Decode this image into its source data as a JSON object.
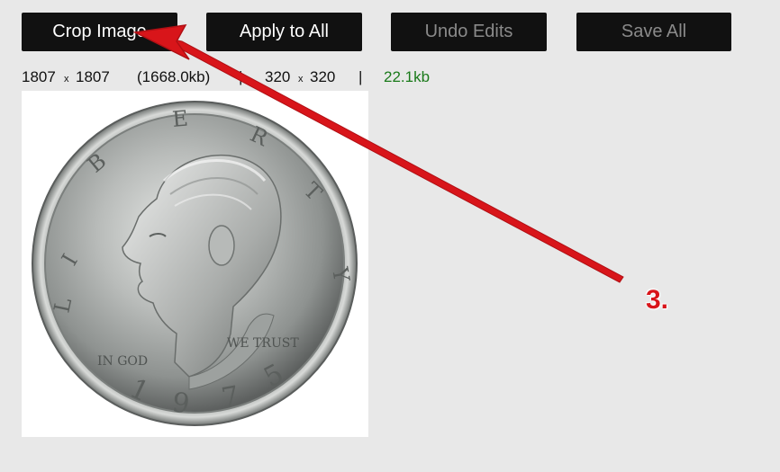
{
  "toolbar": {
    "crop_label": "Crop Image",
    "apply_label": "Apply to All",
    "undo_label": "Undo Edits",
    "save_label": "Save All"
  },
  "image_info": {
    "orig_width": "1807",
    "orig_x": "x",
    "orig_height": "1807",
    "orig_size": "(1668.0kb)",
    "sep1": "|",
    "new_width": "320",
    "new_x": "x",
    "new_height": "320",
    "sep2": "|",
    "new_size": "22.1kb"
  },
  "coin": {
    "legend_top": "LIBERTY",
    "motto_left": "IN GOD",
    "motto_right": "WE TRUST",
    "year": "1975"
  },
  "annotation": {
    "step_label": "3.",
    "color": "#d8151a"
  },
  "colors": {
    "background": "#e8e8e8",
    "button_bg": "#111111",
    "button_text_active": "#ffffff",
    "button_text_disabled": "#8a8a8a",
    "size_new": "#1a7a1a"
  }
}
